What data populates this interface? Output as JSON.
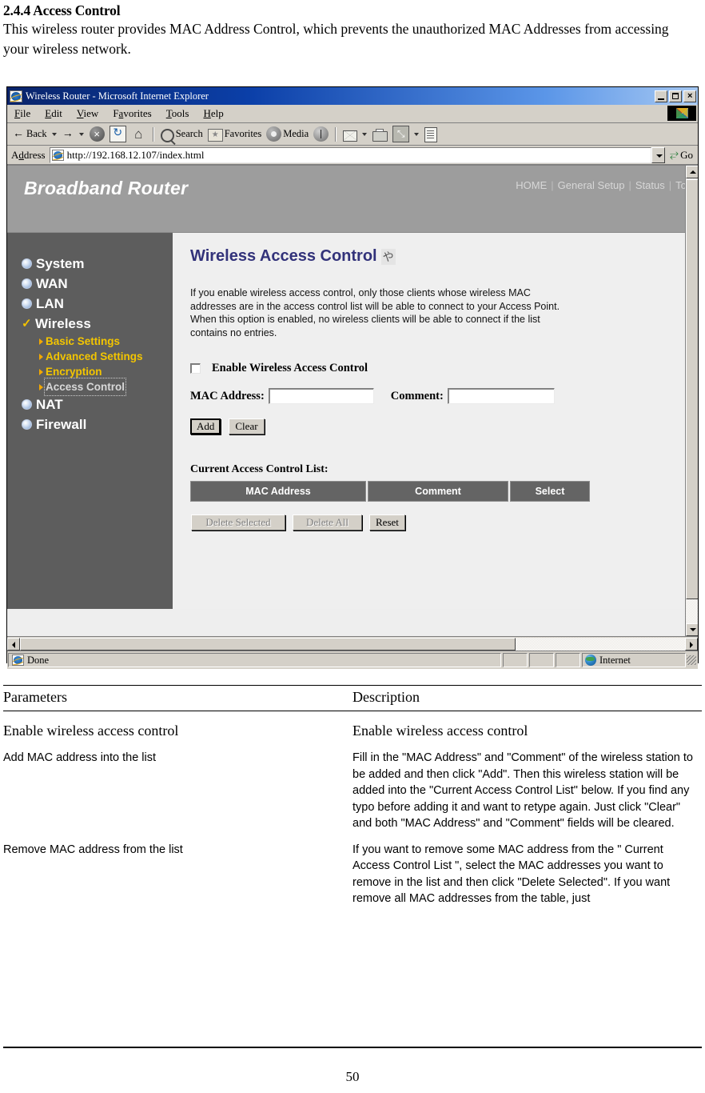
{
  "document": {
    "section_number": "2.4.4",
    "section_title": "2.4.4 Access Control",
    "intro_paragraph": "This wireless router provides MAC Address Control, which prevents the unauthorized MAC Addresses from accessing your wireless network.",
    "page_number": "50"
  },
  "browser": {
    "window_title": "Wireless Router - Microsoft Internet Explorer",
    "window_controls": {
      "minimize": "_",
      "maximize": "□",
      "close": "×"
    },
    "menu": [
      {
        "label": "File",
        "accel": "F"
      },
      {
        "label": "Edit",
        "accel": "E"
      },
      {
        "label": "View",
        "accel": "V"
      },
      {
        "label": "Favorites",
        "accel": "a"
      },
      {
        "label": "Tools",
        "accel": "T"
      },
      {
        "label": "Help",
        "accel": "H"
      }
    ],
    "toolbar": {
      "back_label": "Back",
      "search_label": "Search",
      "favorites_label": "Favorites",
      "media_label": "Media"
    },
    "address": {
      "label": "Address",
      "url": "http://192.168.12.107/index.html",
      "go_label": "Go"
    },
    "status": {
      "text": "Done",
      "zone": "Internet"
    }
  },
  "router": {
    "brand": "Broadband Router",
    "top_nav": [
      "HOME",
      "General Setup",
      "Status",
      "Tool"
    ],
    "sidebar": [
      {
        "label": "System",
        "type": "main",
        "icon": "bullet-icon"
      },
      {
        "label": "WAN",
        "type": "main",
        "icon": "bullet-icon"
      },
      {
        "label": "LAN",
        "type": "main",
        "icon": "bullet-icon"
      },
      {
        "label": "Wireless",
        "type": "main",
        "icon": "check-icon",
        "selected": true
      },
      {
        "label": "Basic Settings",
        "type": "sub",
        "icon": "triangle-icon"
      },
      {
        "label": "Advanced Settings",
        "type": "sub",
        "icon": "triangle-icon"
      },
      {
        "label": "Encryption",
        "type": "sub",
        "icon": "triangle-icon"
      },
      {
        "label": "Access Control",
        "type": "sub",
        "icon": "triangle-icon",
        "active": true
      },
      {
        "label": "NAT",
        "type": "main",
        "icon": "bullet-icon"
      },
      {
        "label": "Firewall",
        "type": "main",
        "icon": "bullet-icon"
      }
    ],
    "page": {
      "title": "Wireless Access Control",
      "title_glyph": "や",
      "description": "If you enable wireless access control, only those clients whose wireless MAC addresses are in the access control list will be able to connect to your Access Point. When this option is enabled, no wireless clients will be able to connect if the list contains no entries.",
      "enable_checkbox_label": "Enable Wireless Access Control",
      "enable_checkbox_checked": false,
      "mac_label": "MAC Address:",
      "mac_value": "",
      "comment_label": "Comment:",
      "comment_value": "",
      "add_button": "Add",
      "clear_button": "Clear",
      "list_caption": "Current Access Control List:",
      "table_headers": [
        "MAC Address",
        "Comment",
        "Select"
      ],
      "table_rows": [],
      "delete_selected_button": "Delete Selected",
      "delete_all_button": "Delete All",
      "reset_button": "Reset"
    }
  },
  "params_table": {
    "headers": {
      "parameters": "Parameters",
      "description": "Description"
    },
    "rows": [
      {
        "parameter": "Enable wireless access control",
        "description": "Enable wireless access control",
        "param_style": "serif",
        "desc_style": "serif"
      },
      {
        "parameter": "Add MAC address into the list",
        "description": "Fill in the \"MAC Address\" and \"Comment\" of the wireless station to be added and then click \"Add\". Then this wireless station will be added into the \"Current Access Control List\" below. If you find any typo before adding it and want to retype again. Just click \"Clear\" and both \"MAC Address\" and \"Comment\" fields will be cleared.",
        "param_style": "sans",
        "desc_style": "sans"
      },
      {
        "parameter": "Remove MAC address from the list",
        "description": "If you want to remove some MAC address from the \" Current Access Control List \", select the MAC addresses you want to remove in the list and then click \"Delete Selected\". If you want remove all MAC addresses from the table, just",
        "param_style": "sans",
        "desc_style": "sans"
      }
    ]
  },
  "colors": {
    "banner_grey": "#9d9d9d",
    "sidebar_grey": "#5d5d5d",
    "content_grey": "#efefef",
    "title_navy": "#32327a",
    "submenu_yellow": "#f3c500",
    "table_header_grey": "#646464",
    "titlebar_blue": "#0a246a"
  }
}
